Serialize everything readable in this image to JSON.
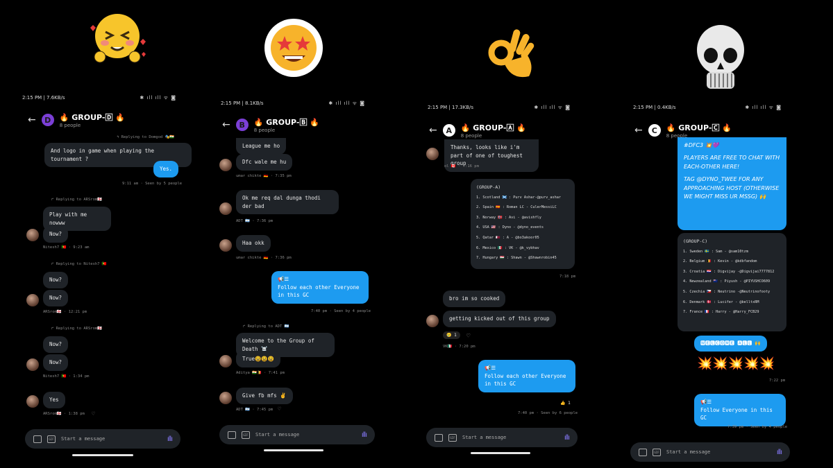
{
  "status_icons": "✱ ıll ıll ᯤ ◙",
  "p1": {
    "time": "2:15 PM | 7.6KB/s",
    "group": "🔥 GROUP-🄳 🔥",
    "avatar": "D",
    "people": "8 people",
    "reply1": "↰ Replying to Domgod 🎭🇮🇳",
    "m1": "And logo in game when playing the tournament ?",
    "m2": "Yes.",
    "meta1": "9:11 am · Seen by 5 people",
    "reply2": "↱ Replying to ARSrom🏴󠁧󠁢󠁥󠁮󠁧󠁿",
    "m3": "Play with me nowww",
    "m4": "Now?",
    "meta2": "Nitesh7 🇵🇹 · 9:23 am",
    "reply3": "↱ Replying to Nitesh7 🇵🇹",
    "m5": "Now?",
    "m6": "Now?",
    "meta3": "ARSrom🏴󠁧󠁢󠁥󠁮󠁧󠁿 · 12:21 pm",
    "reply4": "↱ Replying to ARSrom🏴󠁧󠁢󠁥󠁮󠁧󠁿",
    "m7": "Now?",
    "m8": "Now?",
    "meta4": "Nitesh7 🇵🇹 · 1:34 pm",
    "m9": "Yes",
    "meta5": "ARSrom🏴󠁧󠁢󠁥󠁮󠁧󠁿 · 1:38 pm",
    "placeholder": "Start a message"
  },
  "p2": {
    "time": "2:15 PM | 8.1KB/s",
    "group": "🔥 GROUP-🄱 🔥",
    "avatar": "B",
    "people": "8 people",
    "m1": "League me ho",
    "m2": "Dfc wale me hu",
    "meta1": "umar chikte 🇩🇪 · 7:35 pm",
    "m3": "Ok me req dal dunga thodi der bad",
    "meta2": "ADT 🇦🇷 · 7:36 pm",
    "m4": "Haa okk",
    "meta3": "umar chikte 🇩🇪 · 7:36 pm",
    "m5a": "📢☰",
    "m5": "Follow each other Everyone in this GC",
    "meta4": "7:40 pm · Seen by 4 people",
    "reply": "↱ Replying to ADT 🇦🇷",
    "m6": "Welcome to the Group of Death ☠️",
    "m7": "True😫😫😫",
    "meta5": "Aditya 🇮🇳🇧🇪 · 7:41 pm",
    "m8": "Give fb mfs ✌️",
    "meta6": "ADT 🇦🇷 · 7:45 pm",
    "placeholder": "Start a message"
  },
  "p3": {
    "time": "2:15 PM | 17.3KB/s",
    "group": "🔥 GROUP-🄰 🔥",
    "avatar": "A",
    "people": "8 people",
    "m1": "Thanks, looks like i'm part of one of toughest group",
    "meta1": "ol 🇨🇦 · 7:16 pm",
    "card_title": "(GROUP-A)",
    "card": [
      "1. Scotland 🏴󠁧󠁢󠁳󠁣󠁴󠁿 : Purv Ashar-@purv_ashar",
      "2. Spain 🇪🇸 : Roman LC - CulerMessiLC",
      "3. Norway 🇳🇴 : Avi - @avishfly",
      "4. USA 🇺🇸 : Dyno - @dyno_events",
      "5. Qatar 🇶🇦 : A - @bo3akoor05",
      "6. Mexico 🇲🇽 : VK - @k_vybhav",
      "7. Hungary 🇭🇺 : Shawn - @Shawnrobin45"
    ],
    "meta2": "7:18 pm",
    "m2": "bro im so cooked",
    "m3": "getting kicked out of this group",
    "react": "🥲 1",
    "meta3": "VK🇲🇽 · 7:20 pm",
    "m4a": "📢☰",
    "m4": "Follow each other Everyone in this GC",
    "react2": "👍 1",
    "meta4": "7:40 pm · Seen by 6 people",
    "placeholder": "Start a message"
  },
  "p4": {
    "time": "2:15 PM | 0.4KB/s",
    "group": "🔥 GROUP-🄲 🔥",
    "avatar": "C",
    "people": "8 people",
    "m1a": "#DFC3 💥💜",
    "m1": "PLAYERS ARE FREE TO CHAT WITH EACH-OTHER HERE!",
    "m1b": "TAG @DYNO_TWEE FOR ANY APPROACHING HOST (OTHERWISE WE MIGHT MISS UR MSSG) 🙌",
    "card_title": "(GROUP-C)",
    "card": [
      "1. Sweden 🇸🇪 : Sam - @sam10tzm",
      "2. Belgium 🇧🇪 : Kevin - @kdbfandom",
      "3. Croatia 🇭🇷 : Digvijay -@Digvijai7777812",
      "4. Newzealand 🇳🇿 : Piyush - @PIYUSHCO609",
      "5. Czechia 🇨🇿 : Neutrino -@Neutrinofooty",
      "6. Denmark 🇩🇰 : Lucifer - @belltxRM",
      "7. France 🇫🇷 : Harry - @Harry_FCB29"
    ],
    "m2": "🆆🅴🅻🅲🅾🅼🅴 🅰🅻🅻 🙌",
    "m3": "💥💥💥💥💥",
    "meta1": "7:22 pm",
    "m4a": "📢☰",
    "m4": "Follow Everyone in this GC",
    "meta2": "7:39 pm · Seen by 4 people",
    "placeholder": "Start a message"
  }
}
